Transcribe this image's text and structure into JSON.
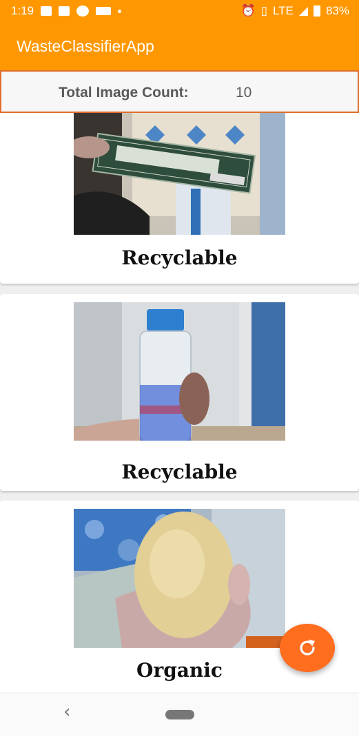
{
  "status_bar": {
    "time": "1:19",
    "network": "LTE",
    "battery": "83%"
  },
  "app": {
    "title": "WasteClassifierApp"
  },
  "counter": {
    "label": "Total Image Count:",
    "value": "10"
  },
  "cards": [
    {
      "label": "Recyclable",
      "image": "boroline-tube-photo"
    },
    {
      "label": "Recyclable",
      "image": "water-bottle-photo"
    },
    {
      "label": "Organic",
      "image": "potato-photo"
    }
  ],
  "fab": {
    "icon": "refresh-icon"
  },
  "colors": {
    "primary": "#ff9800",
    "accent": "#ff6d1f",
    "counter_border": "#e06d2a"
  }
}
